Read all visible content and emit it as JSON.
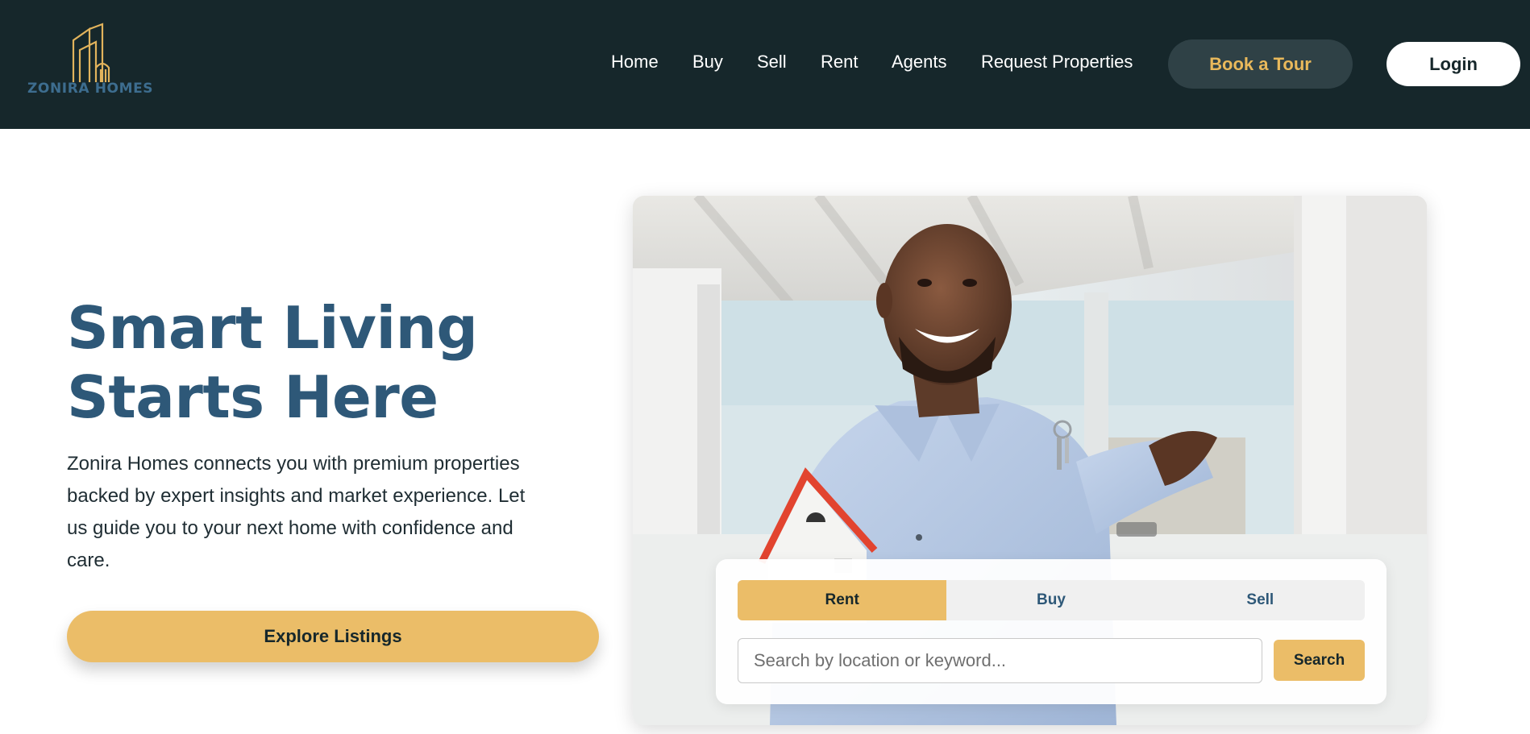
{
  "brand": {
    "name": "ZONIRA HOMES",
    "accent": "#e9b95b",
    "header_bg": "#16272b",
    "logo_icon": "building-outline-logo"
  },
  "nav": {
    "items": [
      {
        "label": "Home"
      },
      {
        "label": "Buy"
      },
      {
        "label": "Sell"
      },
      {
        "label": "Rent"
      },
      {
        "label": "Agents"
      },
      {
        "label": "Request Properties"
      }
    ],
    "book_tour": "Book a Tour",
    "login": "Login"
  },
  "hero": {
    "title": "Smart Living Starts Here",
    "description": "Zonira Homes connects you with premium properties backed by expert insights and market experience. Let us guide you to your next home with confidence and care.",
    "cta": "Explore Listings",
    "image": "photo of smiling man holding a toy house and keys"
  },
  "search": {
    "tabs": [
      {
        "label": "Rent",
        "active": true
      },
      {
        "label": "Buy",
        "active": false
      },
      {
        "label": "Sell",
        "active": false
      }
    ],
    "placeholder": "Search by location or keyword...",
    "button": "Search"
  }
}
